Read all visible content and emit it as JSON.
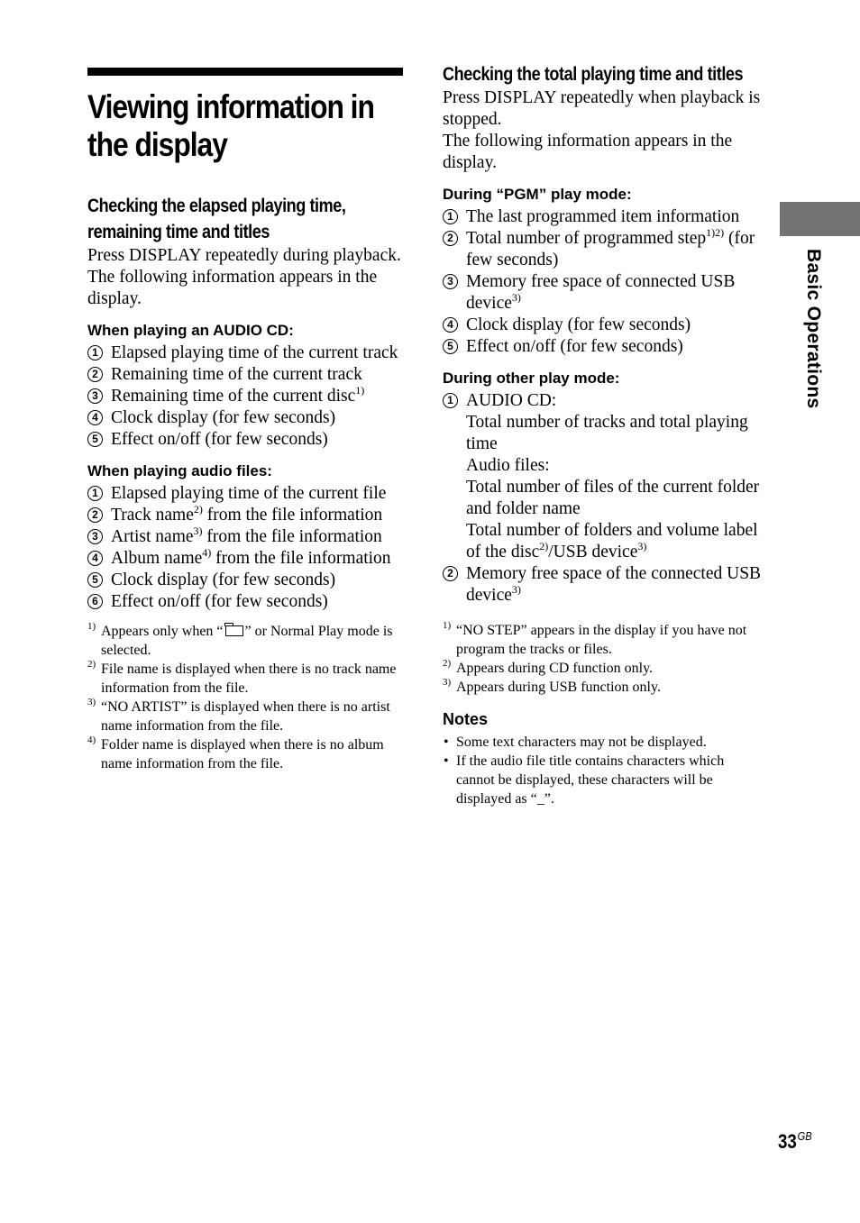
{
  "page": {
    "title": "Viewing information in the display",
    "section_tab": "Basic Operations",
    "page_number": "33",
    "page_suffix": "GB"
  },
  "left": {
    "section_title": "Checking the elapsed playing time, remaining time and titles",
    "intro": [
      "Press DISPLAY repeatedly during playback.",
      "The following information appears in the display."
    ],
    "audio_cd": {
      "heading": "When playing an AUDIO CD:",
      "items": [
        {
          "num": "1",
          "text": "Elapsed playing time of the current track",
          "fn": ""
        },
        {
          "num": "2",
          "text": "Remaining time of the current track",
          "fn": ""
        },
        {
          "num": "3",
          "text": "Remaining time of the current disc",
          "fn": "1)"
        },
        {
          "num": "4",
          "text": "Clock display (for few seconds)",
          "fn": ""
        },
        {
          "num": "5",
          "text": "Effect on/off (for few seconds)",
          "fn": ""
        }
      ]
    },
    "audio_files": {
      "heading": "When playing audio files:",
      "items": [
        {
          "num": "1",
          "text": "Elapsed playing time of the current file",
          "fn": "",
          "rest": ""
        },
        {
          "num": "2",
          "text": "Track name",
          "fn": "2)",
          "rest": " from the file information"
        },
        {
          "num": "3",
          "text": "Artist name",
          "fn": "3)",
          "rest": " from the file information"
        },
        {
          "num": "4",
          "text": "Album name",
          "fn": "4)",
          "rest": " from the file information"
        },
        {
          "num": "5",
          "text": "Clock display (for few seconds)",
          "fn": "",
          "rest": ""
        },
        {
          "num": "6",
          "text": "Effect on/off (for few seconds)",
          "fn": "",
          "rest": ""
        }
      ]
    },
    "footnotes": [
      {
        "mark": "1)",
        "before": "Appears only when “",
        "icon": "folder-icon",
        "after": "” or Normal Play mode is selected."
      },
      {
        "mark": "2)",
        "text": "File name is displayed when there is no track name information from the file."
      },
      {
        "mark": "3)",
        "text": "“NO ARTIST” is displayed when there is no artist name information from the file."
      },
      {
        "mark": "4)",
        "text": "Folder name is displayed when there is no album name information from the file."
      }
    ]
  },
  "right": {
    "section_title": "Checking the total playing time and titles",
    "intro": [
      "Press DISPLAY repeatedly when playback is stopped.",
      "The following information appears in the display."
    ],
    "pgm_mode": {
      "heading": "During “PGM” play mode:",
      "items": [
        {
          "num": "1",
          "text": "The last programmed item information",
          "fn": "",
          "rest": ""
        },
        {
          "num": "2",
          "text": "Total number of programmed step",
          "fn": "1)2)",
          "rest": " (for few seconds)"
        },
        {
          "num": "3",
          "text": "Memory free space of connected USB device",
          "fn": "3)",
          "rest": ""
        },
        {
          "num": "4",
          "text": "Clock display (for few seconds)",
          "fn": "",
          "rest": ""
        },
        {
          "num": "5",
          "text": "Effect on/off (for few seconds)",
          "fn": "",
          "rest": ""
        }
      ]
    },
    "other_mode": {
      "heading": "During other play mode:",
      "item1": {
        "num": "1",
        "label": "AUDIO CD:",
        "lines": [
          "Total number of tracks and total playing time",
          "Audio files:",
          "Total number of files of the current folder and folder name"
        ],
        "last_a": "Total number of folders and volume label of the disc",
        "last_fn1": "2)",
        "last_b": "/USB device",
        "last_fn2": "3)"
      },
      "item2": {
        "num": "2",
        "text": "Memory free space of the connected USB device",
        "fn": "3)"
      }
    },
    "footnotes": [
      {
        "mark": "1)",
        "text": "“NO STEP” appears in the display if you have not program the tracks or files."
      },
      {
        "mark": "2)",
        "text": "Appears during CD function only."
      },
      {
        "mark": "3)",
        "text": "Appears during USB function only."
      }
    ],
    "notes": {
      "heading": "Notes",
      "items": [
        "Some text characters may not be displayed.",
        "If the audio file title contains characters which cannot be displayed, these characters will be displayed as “_”."
      ]
    }
  }
}
